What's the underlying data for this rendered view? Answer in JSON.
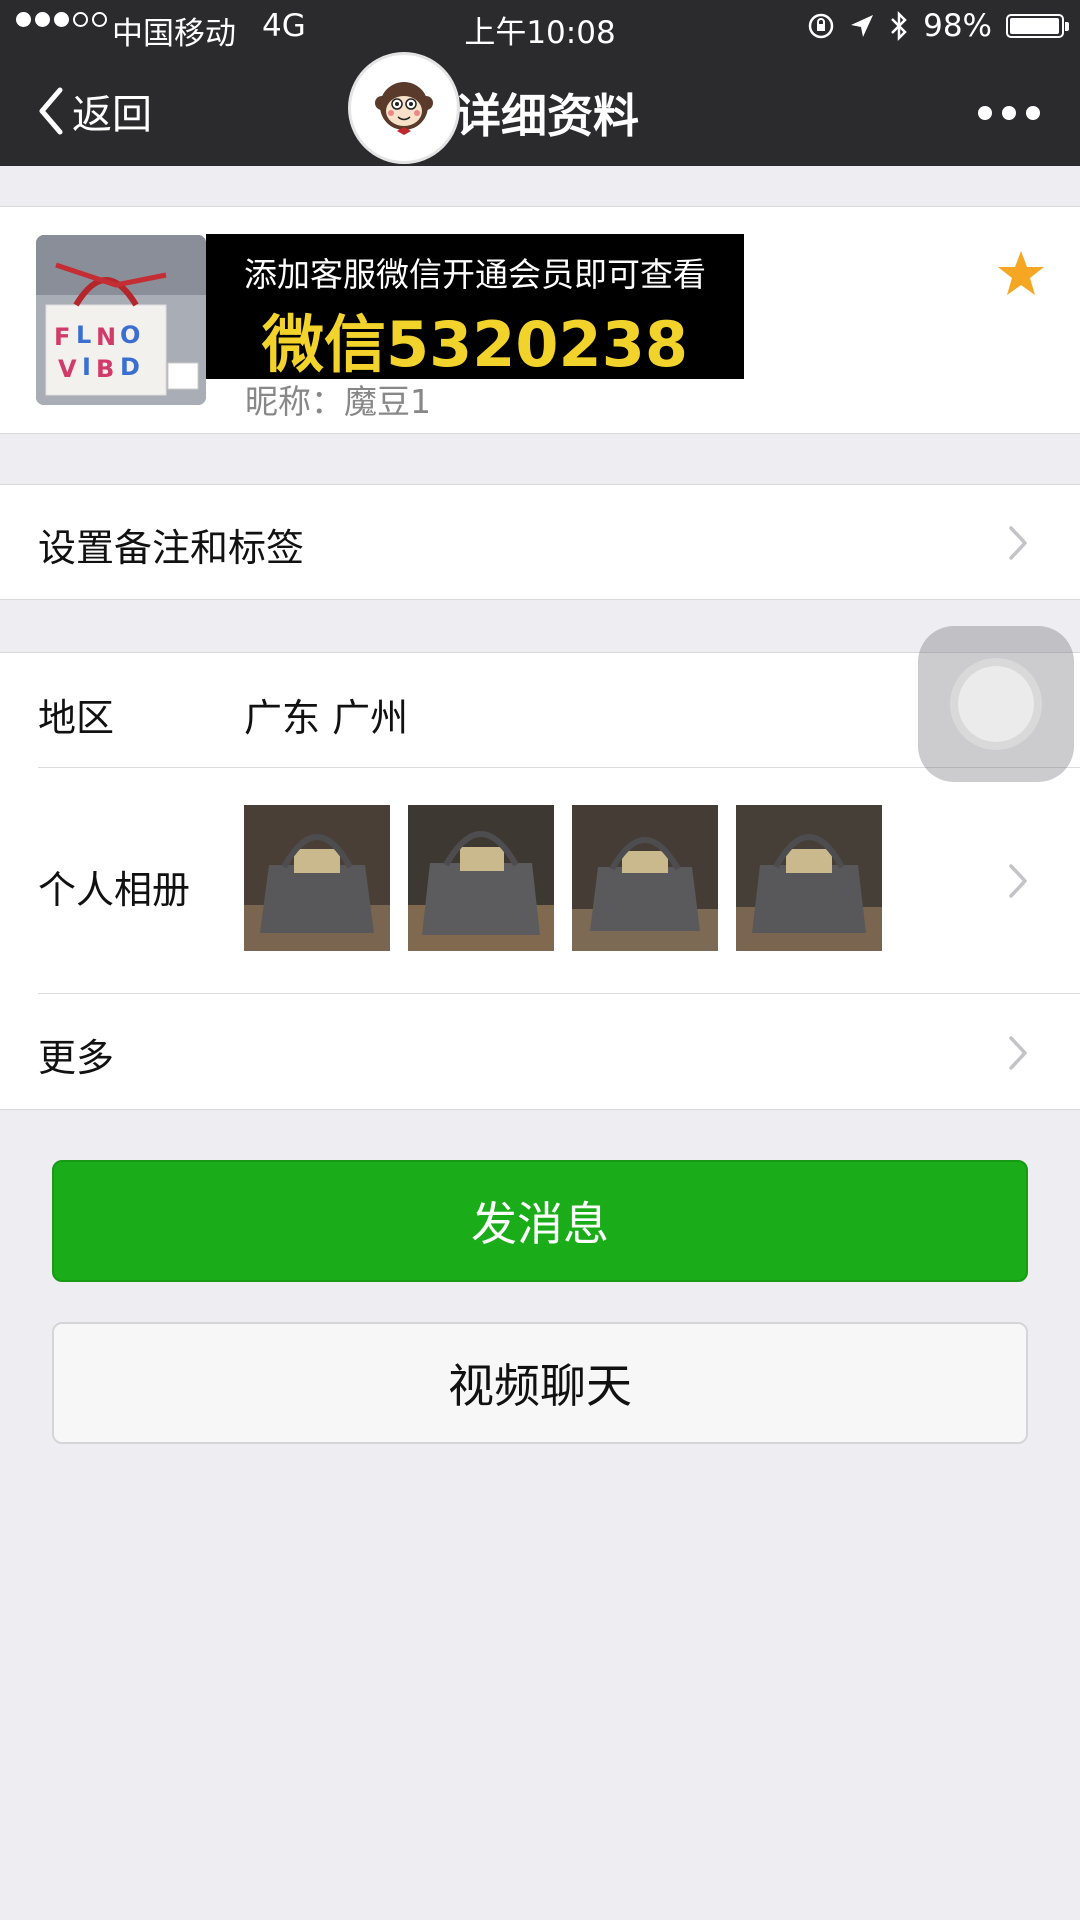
{
  "status_bar": {
    "carrier": "中国移动",
    "network": "4G",
    "time": "上午10:08",
    "battery_text": "98%",
    "battery_level": 0.98,
    "signal_bars": 3,
    "signal_total": 5
  },
  "nav": {
    "back_label": "返回",
    "title": "详细资料"
  },
  "profile": {
    "nickname": "昵称：魔豆1",
    "starred": true
  },
  "promo": {
    "line1": "添加客服微信开通会员即可查看",
    "line2": "微信5320238"
  },
  "rows": {
    "remark_label": "设置备注和标签",
    "region_label": "地区",
    "region_value": "广东 广州",
    "album_label": "个人相册",
    "more_label": "更多"
  },
  "buttons": {
    "send_message": "发消息",
    "video_chat": "视频聊天"
  },
  "colors": {
    "nav_bg": "#2b2b2e",
    "primary_green": "#1aad19",
    "star": "#f5a623",
    "promo_yellow": "#f2d32b"
  },
  "icons": [
    "chevron-left-icon",
    "more-dots-icon",
    "star-icon",
    "chevron-right-icon",
    "lock-rotation-icon",
    "location-arrow-icon",
    "bluetooth-icon",
    "battery-icon"
  ]
}
